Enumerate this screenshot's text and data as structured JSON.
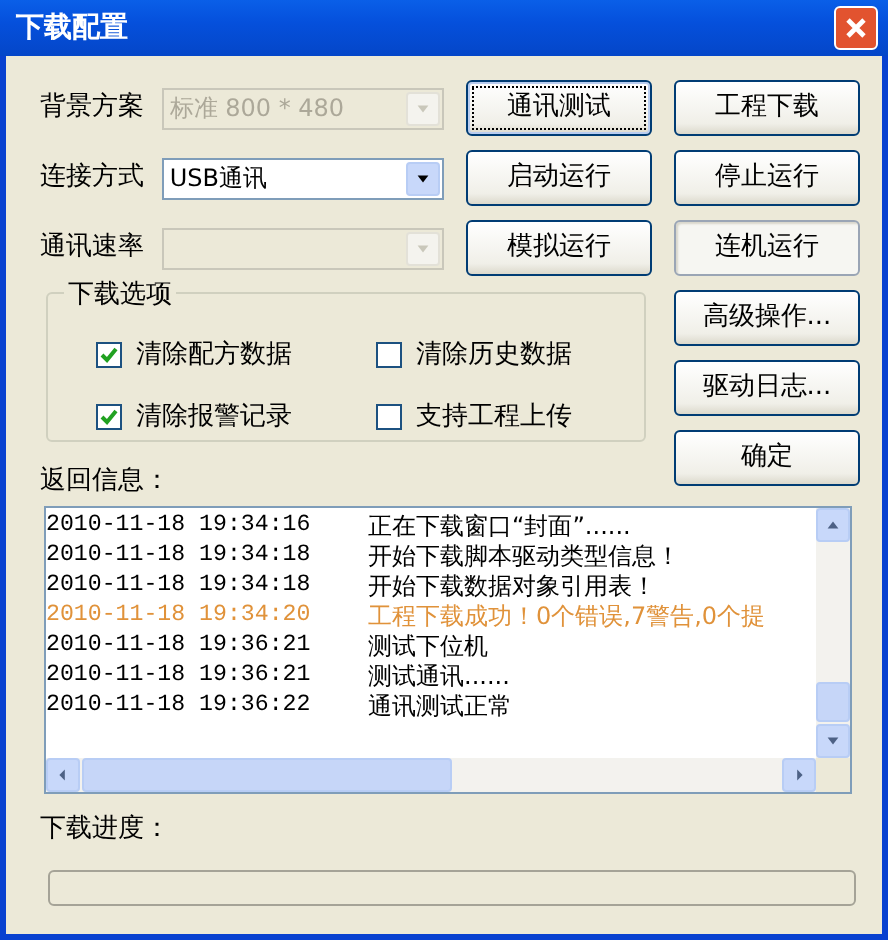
{
  "window": {
    "title": "下载配置"
  },
  "fields": [
    {
      "label": "背景方案",
      "value": "标准 800 * 480",
      "disabled": true
    },
    {
      "label": "连接方式",
      "value": "USB通讯",
      "disabled": false
    },
    {
      "label": "通讯速率",
      "disabled": true
    }
  ],
  "test_buttons": [
    {
      "label": "通讯测试",
      "focused": true,
      "pressed": false
    },
    {
      "label": "启动运行",
      "focused": false,
      "pressed": false
    },
    {
      "label": "模拟运行",
      "focused": false,
      "pressed": false
    }
  ],
  "action_buttons": [
    {
      "label": "工程下载",
      "focused": false,
      "pressed": false
    },
    {
      "label": "停止运行",
      "focused": false,
      "pressed": false
    },
    {
      "label": "连机运行",
      "focused": false,
      "pressed": true
    },
    {
      "label": "高级操作...",
      "focused": false,
      "pressed": false
    },
    {
      "label": "驱动日志...",
      "focused": false,
      "pressed": false
    },
    {
      "label": "确定",
      "focused": false,
      "pressed": false
    }
  ],
  "download_options": {
    "title": "下载选项",
    "options": [
      {
        "label": "清除配方数据",
        "checked": true
      },
      {
        "label": "清除历史数据",
        "checked": false
      },
      {
        "label": "清除报警记录",
        "checked": true
      },
      {
        "label": "支持工程上传",
        "checked": false
      }
    ]
  },
  "log": {
    "label": "返回信息：",
    "rows": [
      {
        "time": "2010-11-18 19:34:16",
        "message": "正在下载窗口“封面”......",
        "color": "#000000"
      },
      {
        "time": "2010-11-18 19:34:18",
        "message": "开始下载脚本驱动类型信息！",
        "color": "#000000"
      },
      {
        "time": "2010-11-18 19:34:18",
        "message": "开始下载数据对象引用表！",
        "color": "#000000"
      },
      {
        "time": "2010-11-18 19:34:20",
        "message": "工程下载成功！0个错误,7警告,0个提",
        "color": "#e0923a"
      },
      {
        "time": "2010-11-18 19:36:21",
        "message": "测试下位机",
        "color": "#000000"
      },
      {
        "time": "2010-11-18 19:36:21",
        "message": "测试通讯......",
        "color": "#000000"
      },
      {
        "time": "2010-11-18 19:36:22",
        "message": "通讯测试正常",
        "color": "#000000"
      }
    ]
  },
  "progress": {
    "label": "下载进度：",
    "level": 0
  }
}
